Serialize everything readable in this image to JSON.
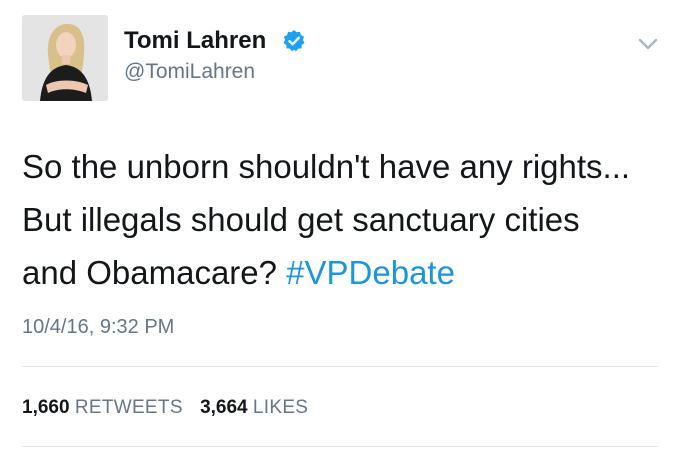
{
  "tweet": {
    "author": {
      "name": "Tomi Lahren",
      "handle": "@TomiLahren",
      "verified": true
    },
    "text_lines": [
      "So the unborn shouldn't have any rights...",
      "But illegals should get sanctuary cities",
      "and Obamacare? "
    ],
    "hashtag": "#VPDebate",
    "timestamp": "10/4/16, 9:32 PM",
    "stats": {
      "retweets_count": "1,660",
      "retweets_label": "RETWEETS",
      "likes_count": "3,664",
      "likes_label": "LIKES"
    },
    "icons": {
      "verified": "verified-badge-icon",
      "menu": "chevron-down-icon"
    },
    "colors": {
      "text": "#14171a",
      "secondary": "#657786",
      "link": "#1b95e0",
      "verified": "#1da1f2",
      "divider": "#e1e8ed"
    }
  }
}
